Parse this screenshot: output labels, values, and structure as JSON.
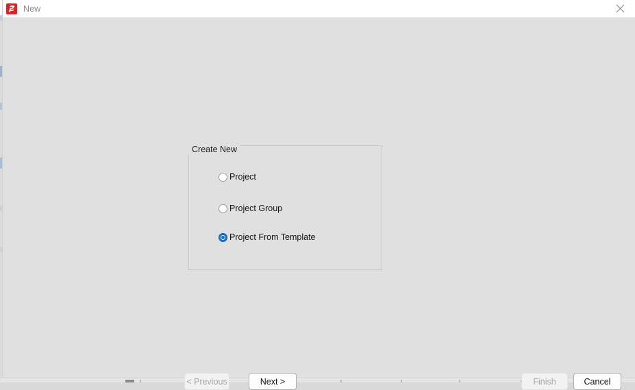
{
  "window": {
    "title": "New",
    "icon": "rad-studio-logo-icon",
    "close_icon": "close-icon",
    "accent_color": "#dd2222",
    "titlebar_bg": "#ffffff",
    "body_bg": "#e0e0e0"
  },
  "group": {
    "title": "Create New",
    "options": [
      {
        "label": "Project",
        "checked": false
      },
      {
        "label": "Project Group",
        "checked": false
      },
      {
        "label": "Project From Template",
        "checked": true
      }
    ],
    "selected": "Project From Template",
    "selected_color": "#0f6cbe"
  },
  "footer": {
    "previous_label": "< Previous",
    "previous_enabled": false,
    "next_label": "Next >",
    "next_enabled": true,
    "finish_label": "Finish",
    "finish_enabled": false,
    "cancel_label": "Cancel",
    "cancel_enabled": true
  }
}
